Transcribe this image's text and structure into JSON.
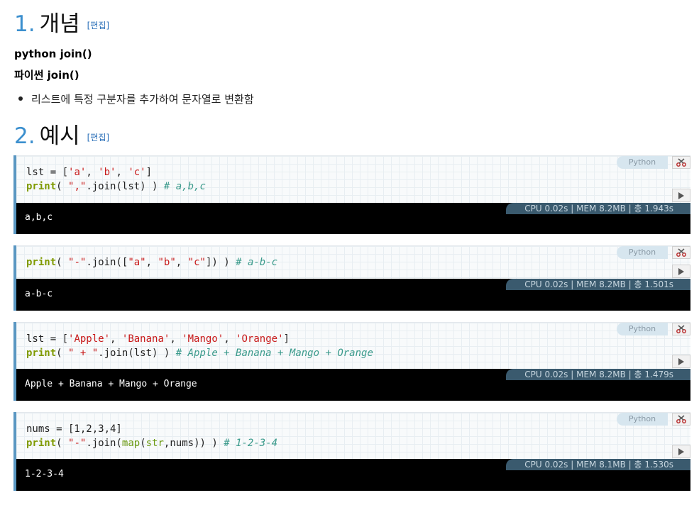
{
  "section1": {
    "number": "1.",
    "title": "개념",
    "edit": "[편집]"
  },
  "intro": {
    "line1": "python join()",
    "line2": "파이썬 join()"
  },
  "bullets": [
    "리스트에 특정 구분자를 추가하여 문자열로 변환함"
  ],
  "section2": {
    "number": "2.",
    "title": "예시",
    "edit": "[편집]"
  },
  "language_label": "Python",
  "examples": [
    {
      "output": "a,b,c",
      "stats": "CPU 0.02s | MEM 8.2MB | 총 1.943s"
    },
    {
      "output": "a-b-c",
      "stats": "CPU 0.02s | MEM 8.2MB | 총 1.501s"
    },
    {
      "output": "Apple + Banana + Mango + Orange",
      "stats": "CPU 0.02s | MEM 8.2MB | 총 1.479s"
    },
    {
      "output": "1-2-3-4",
      "stats": "CPU 0.02s | MEM 8.1MB | 총 1.530s"
    }
  ],
  "icons": {
    "copy": "scissors-icon",
    "run": "play-icon"
  },
  "colors": {
    "accent": "#3b8fce",
    "block_border": "#5a97c2",
    "stats_bg": "#3a5a6e"
  }
}
